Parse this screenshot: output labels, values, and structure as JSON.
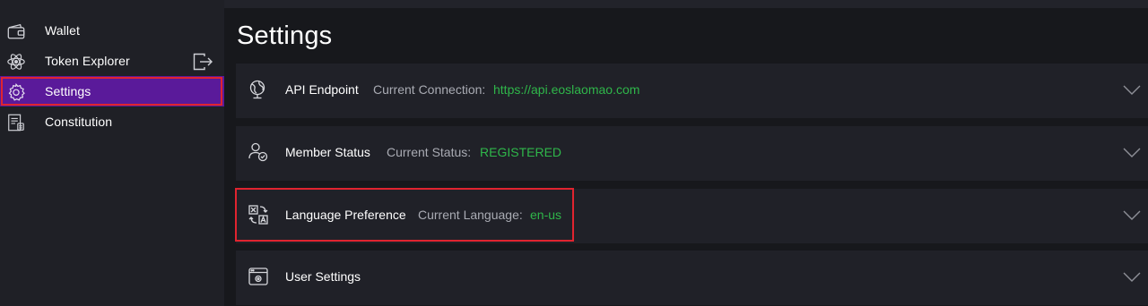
{
  "sidebar": {
    "items": [
      {
        "label": "Wallet",
        "icon": "wallet-icon"
      },
      {
        "label": "Token Explorer",
        "icon": "atom-icon",
        "trailing_icon": "exit-icon"
      },
      {
        "label": "Settings",
        "icon": "gear-icon",
        "active": true
      },
      {
        "label": "Constitution",
        "icon": "document-icon"
      }
    ]
  },
  "main": {
    "title": "Settings",
    "panels": [
      {
        "title": "API Endpoint",
        "key": "Current Connection:",
        "value": "https://api.eoslaomao.com",
        "icon": "globe-icon"
      },
      {
        "title": "Member Status",
        "key": "Current Status:",
        "value": "REGISTERED",
        "icon": "user-check-icon"
      },
      {
        "title": "Language Preference",
        "key": "Current Language:",
        "value": "en-us",
        "icon": "translate-icon"
      },
      {
        "title": "User Settings",
        "key": "",
        "value": "",
        "icon": "window-gear-icon"
      }
    ]
  },
  "colors": {
    "accent_active": "#5a1a9a",
    "value_green": "#2fb64a",
    "highlight_red": "#e0242f",
    "panel_bg": "#202128",
    "sidebar_bg": "#1f2026",
    "main_bg": "#17181c"
  }
}
